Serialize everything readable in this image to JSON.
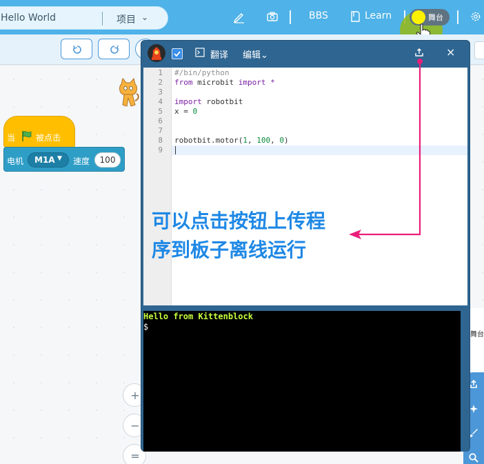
{
  "header": {
    "project_title": "Hello World",
    "project_menu": "项目",
    "bbs_label": "BBS",
    "learn_label": "Learn",
    "stage_toggle_label": "舞台"
  },
  "workspace": {
    "hat_block": {
      "when": "当",
      "clicked": "被点击"
    },
    "motor_block": {
      "label": "电机",
      "motor": "M1A",
      "speed_label": "速度",
      "speed_value": "100"
    },
    "zoom": {
      "zoom_in": "+",
      "zoom_out": "−",
      "reset": "="
    },
    "stage_label": "舞台"
  },
  "editor": {
    "translate_label": "翻译",
    "edit_menu_label": "编辑",
    "close_glyph": "×",
    "line_numbers": [
      "1",
      "2",
      "3",
      "4",
      "5",
      "6",
      "7",
      "8",
      "9"
    ],
    "code": {
      "line1": "#/bin/python",
      "line2_kw1": "from",
      "line2_mod": " microbit ",
      "line2_kw2": "import",
      "line2_star": " *",
      "line4_kw": "import",
      "line4_mod": " robotbit",
      "line5_var": "x = ",
      "line5_num": "0",
      "line8_call": "robotbit.motor(",
      "line8_a": "1",
      "line8_sep1": ", ",
      "line8_b": "100",
      "line8_sep2": ", ",
      "line8_c": "0",
      "line8_end": ")"
    },
    "terminal": {
      "line1": "Hello from Kittenblock",
      "prompt": "$"
    }
  },
  "annotation": {
    "line1": "可以点击按钮上传程",
    "line2": "序到板子离线运行",
    "color": "#1e88e5",
    "arrow_color": "#e91e7a"
  },
  "colors": {
    "header": "#4fb2e8",
    "editor_frame": "#2e6591",
    "hat_block": "#ffbf00",
    "motor_block": "#2f9ec7"
  }
}
